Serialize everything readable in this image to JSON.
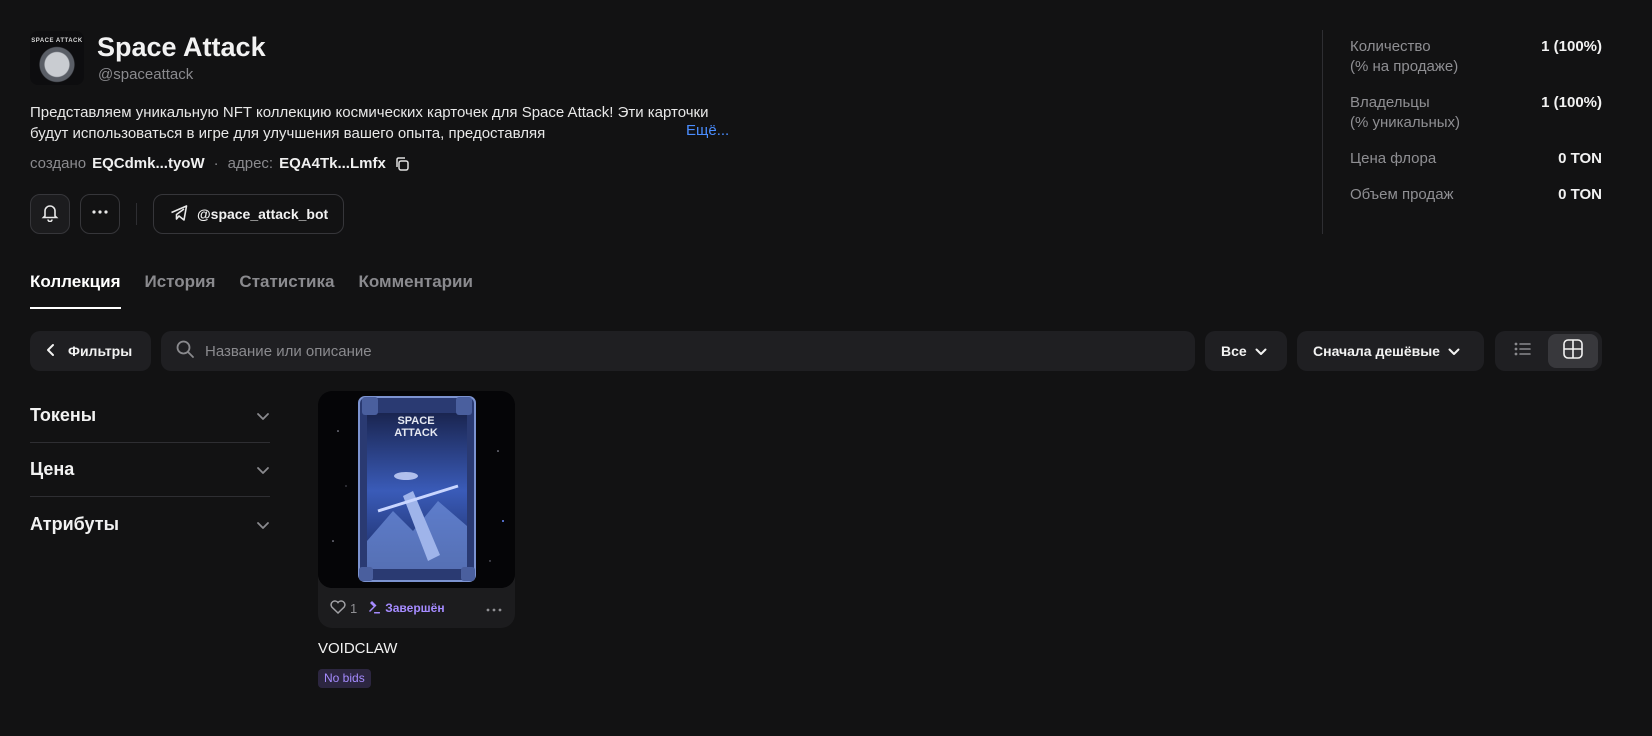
{
  "header": {
    "avatar_text": "SPACE ATTACK",
    "title": "Space Attack",
    "handle": "@spaceattack",
    "description": "Представляем уникальную NFT коллекцию космических карточек для Space Attack! Эти карточки будут использоваться в игре для улучшения вашего опыта, предоставляя",
    "more_label": "Ещё...",
    "created_label": "создано",
    "created_value": "EQCdmk...tyoW",
    "separator": "·",
    "address_label": "адрес:",
    "address_value": "EQA4Tk...Lmfx",
    "bot_label": "@space_attack_bot"
  },
  "stats": [
    {
      "label": "Количество",
      "sublabel": "(% на продаже)",
      "value": "1 (100%)"
    },
    {
      "label": "Владельцы",
      "sublabel": "(% уникальных)",
      "value": "1 (100%)"
    },
    {
      "label": "Цена флора",
      "sublabel": "",
      "value": "0 TON"
    },
    {
      "label": "Объем продаж",
      "sublabel": "",
      "value": "0 TON"
    }
  ],
  "tabs": [
    {
      "label": "Коллекция"
    },
    {
      "label": "История"
    },
    {
      "label": "Статистика"
    },
    {
      "label": "Комментарии"
    }
  ],
  "toolbar": {
    "filters_label": "Фильтры",
    "search_placeholder": "Название или описание",
    "type_select": "Все",
    "sort_select": "Сначала дешёвые"
  },
  "sidebar": {
    "sections": [
      {
        "label": "Токены"
      },
      {
        "label": "Цена"
      },
      {
        "label": "Атрибуты"
      }
    ]
  },
  "items": [
    {
      "image_text": "SPACE ATTACK",
      "likes": "1",
      "status": "Завершён",
      "name": "VOIDCLAW",
      "badge": "No bids"
    }
  ],
  "colors": {
    "background": "#121213",
    "surface": "#1f1f22",
    "accent_link": "#4a8dff",
    "accent_purple": "#a58bff"
  },
  "icons": [
    "bell-icon",
    "more-icon",
    "telegram-icon",
    "copy-icon",
    "chevron-left-icon",
    "search-icon",
    "chevron-down-icon",
    "list-view-icon",
    "grid-view-icon",
    "heart-icon",
    "gavel-icon"
  ]
}
